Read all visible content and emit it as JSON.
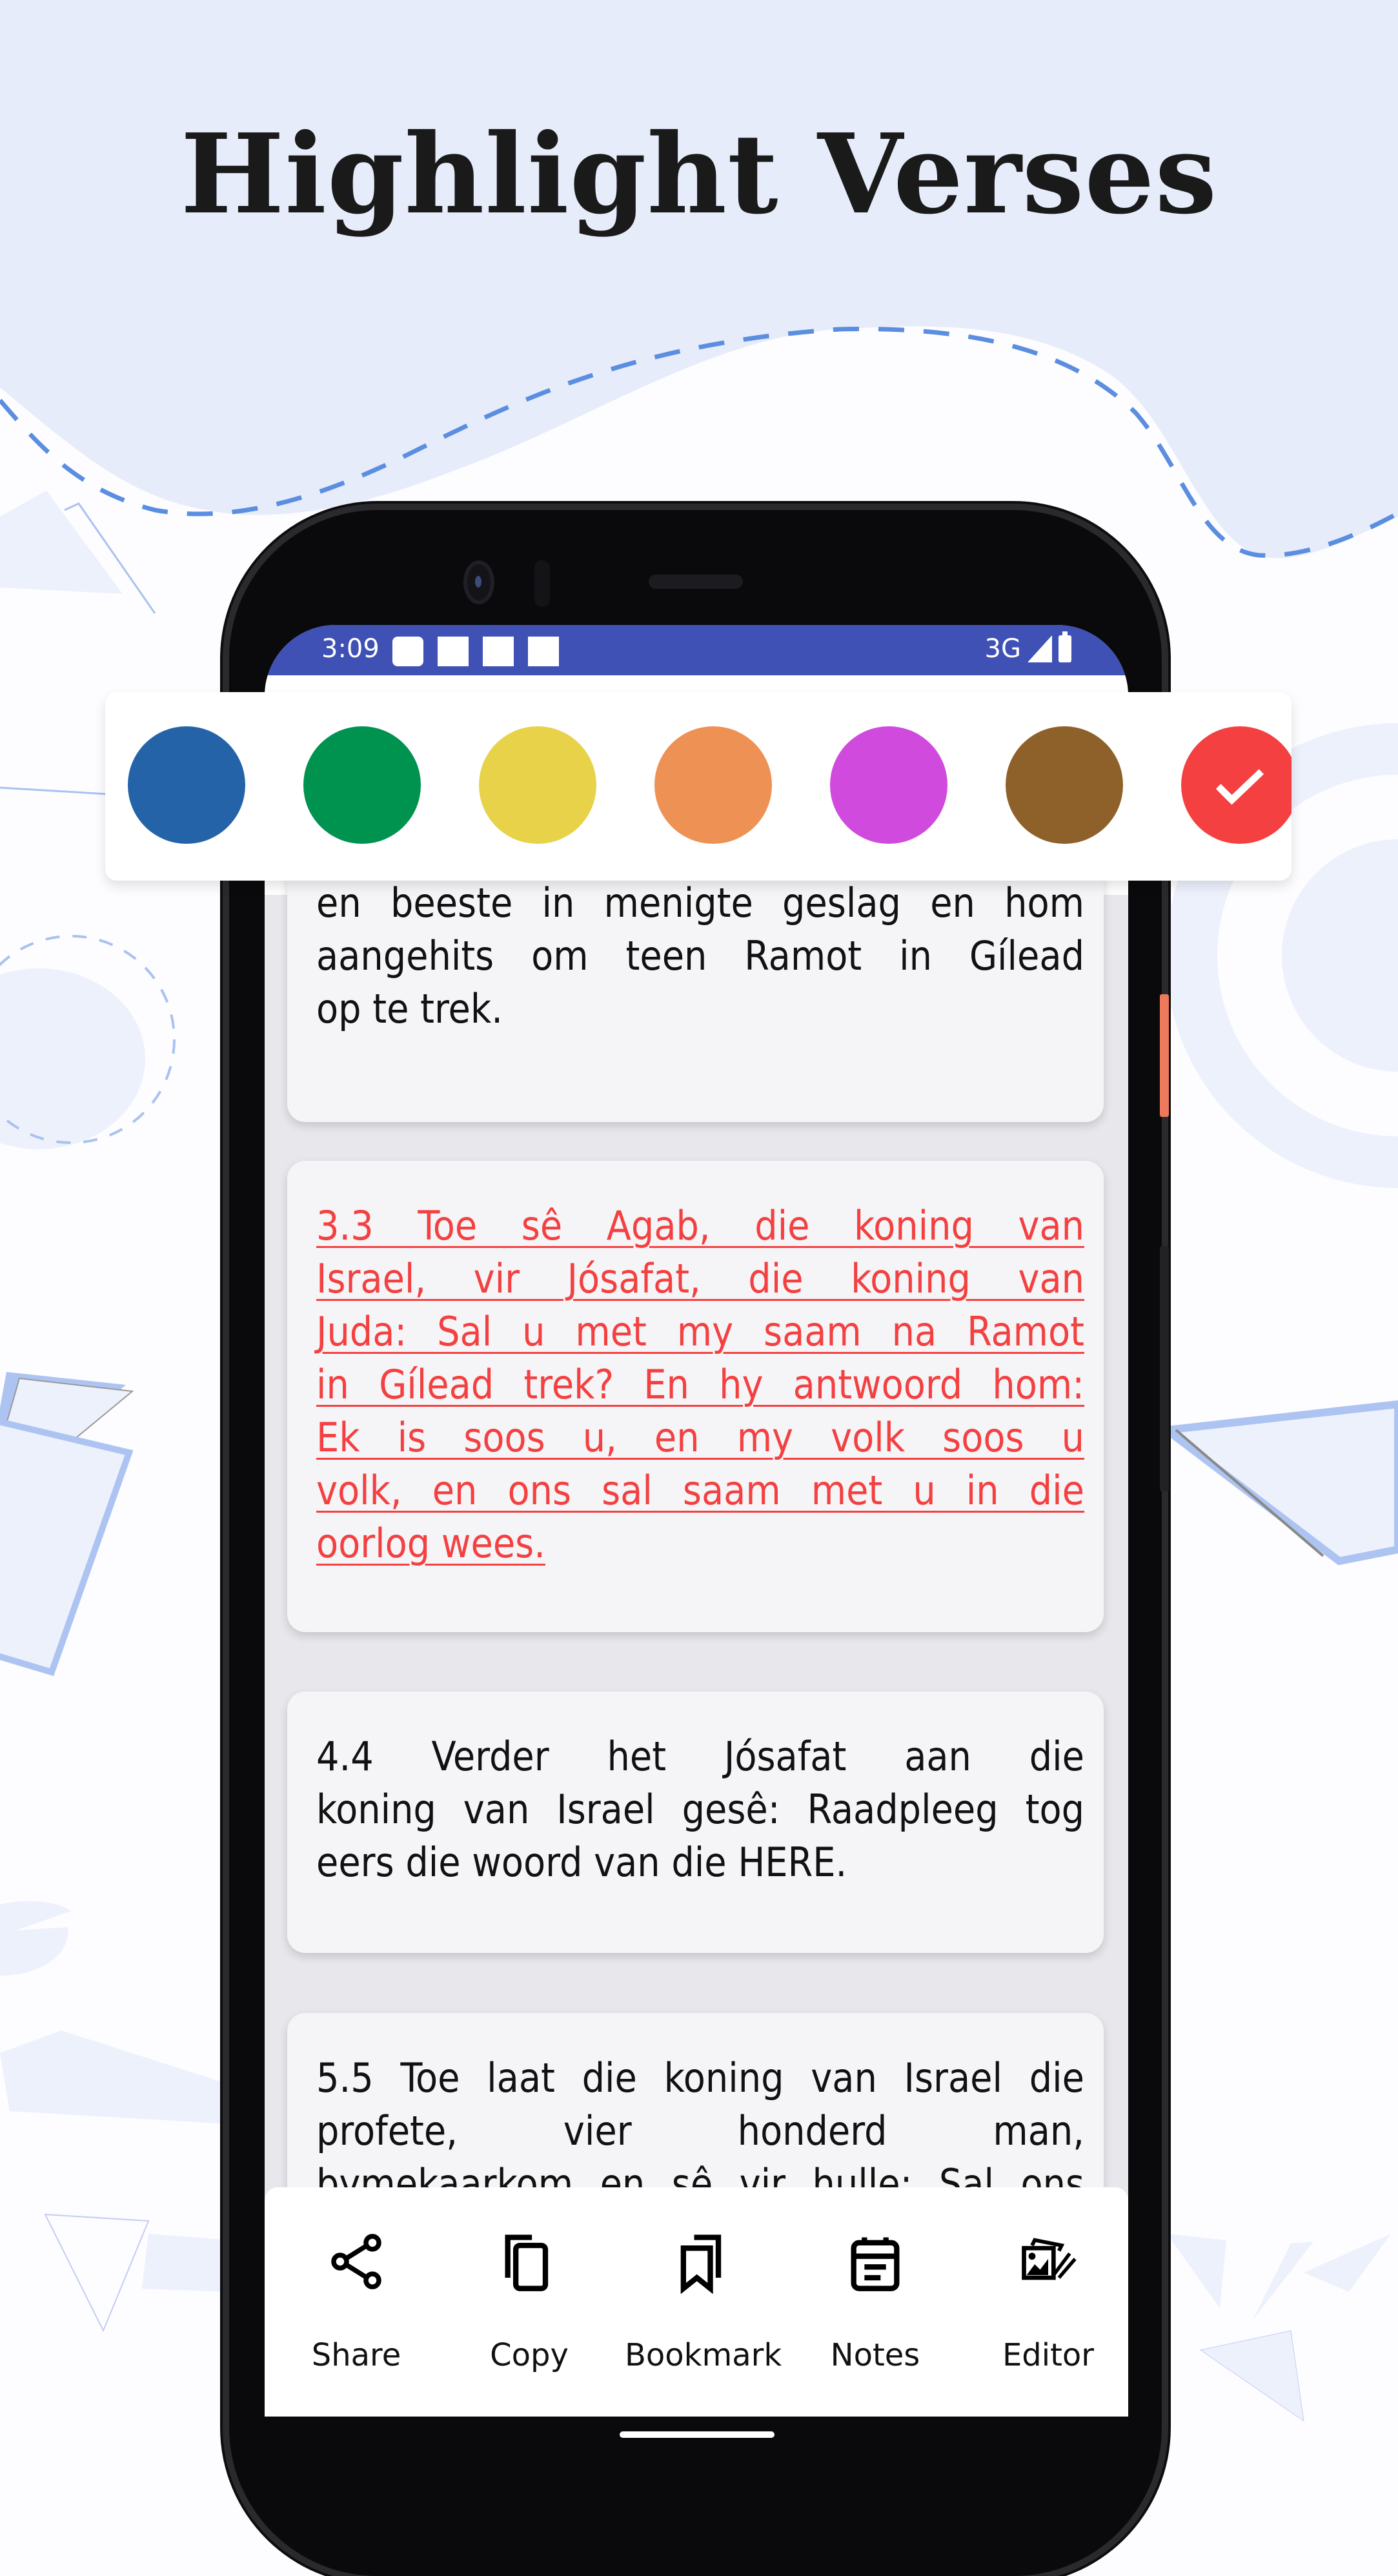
{
  "headline": "Highlight Verses",
  "colors": {
    "background_wave": "#e6ecfa",
    "wave_dash": "#5b8ee0",
    "status_bar": "#3f51b5",
    "highlight_text": "#f44040"
  },
  "status_bar": {
    "time": "3:09",
    "network": "3G",
    "icons": [
      "notification-icon",
      "notification-icon",
      "notification-icon",
      "notification-icon",
      "signal-icon",
      "battery-icon"
    ]
  },
  "palette": {
    "selected_index": 6,
    "swatches": [
      {
        "name": "blue",
        "color": "#2563a9"
      },
      {
        "name": "green",
        "color": "#00934f"
      },
      {
        "name": "yellow",
        "color": "#e8d24a"
      },
      {
        "name": "orange",
        "color": "#ee9155"
      },
      {
        "name": "magenta",
        "color": "#d04ade"
      },
      {
        "name": "brown",
        "color": "#8e612b"
      },
      {
        "name": "red",
        "color": "#f44040"
      }
    ]
  },
  "verses": [
    {
      "id": "2.2",
      "lines": [
        "en beeste in menigte geslag en hom",
        "aangehits om teen Ramot in Gílead",
        "op te trek."
      ],
      "highlighted": false
    },
    {
      "id": "3.3",
      "lines": [
        "3.3 Toe sê Agab, die koning van",
        "Israel, vir Jósafat, die koning van",
        "Juda: Sal u met my saam na Ramot",
        "in Gílead trek? En hy antwoord hom:",
        "Ek is soos u, en my volk soos u",
        "volk, en ons sal saam met u in die",
        "oorlog wees."
      ],
      "highlighted": true
    },
    {
      "id": "4.4",
      "lines": [
        "4.4 Verder het Jósafat aan die",
        "koning van Israel gesê: Raadpleeg tog",
        "eers die woord van die HERE."
      ],
      "highlighted": false
    },
    {
      "id": "5.5",
      "lines": [
        "5.5 Toe laat die koning van Israel die",
        "profete, vier honderd man,",
        "bymekaarkom en sê vir hulle: Sal ons"
      ],
      "highlighted": false
    }
  ],
  "actions": [
    {
      "label": "Share",
      "icon": "share-icon"
    },
    {
      "label": "Copy",
      "icon": "copy-icon"
    },
    {
      "label": "Bookmark",
      "icon": "bookmark-icon"
    },
    {
      "label": "Notes",
      "icon": "notes-icon"
    },
    {
      "label": "Editor",
      "icon": "editor-icon"
    }
  ]
}
